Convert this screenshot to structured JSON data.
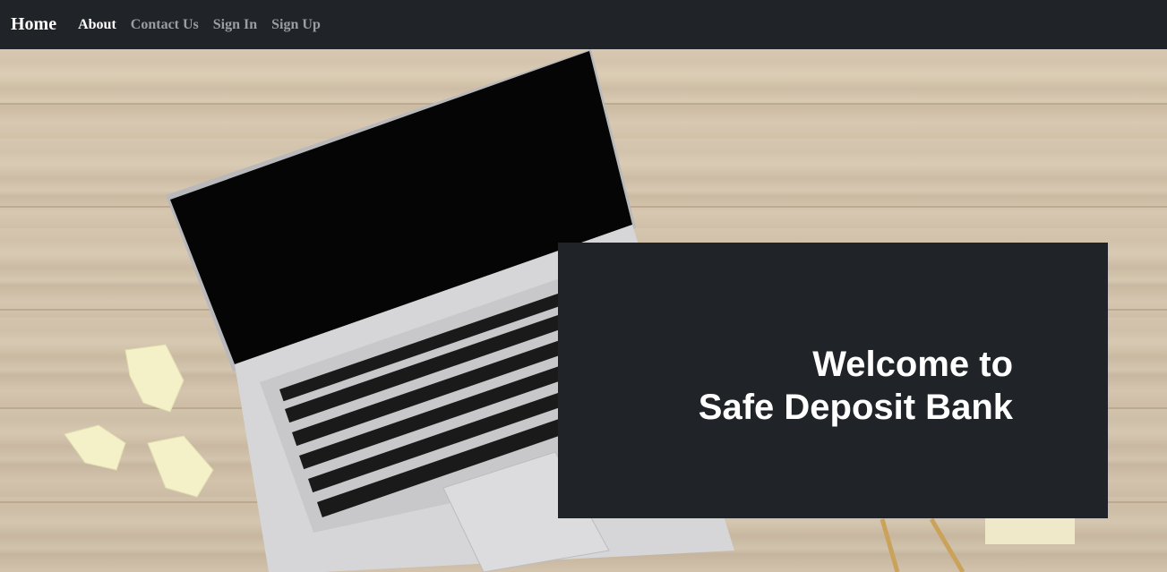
{
  "navbar": {
    "brand": "Home",
    "links": [
      {
        "label": "About",
        "active": true
      },
      {
        "label": "Contact Us",
        "active": false
      },
      {
        "label": "Sign In",
        "active": false
      },
      {
        "label": "Sign Up",
        "active": false
      }
    ]
  },
  "hero": {
    "background_description_icon": "laptop-on-wooden-desk-image"
  },
  "welcome": {
    "line1": "Welcome to",
    "line2": "Safe Deposit Bank"
  },
  "colors": {
    "navbar_bg": "#202327",
    "panel_bg": "#202327",
    "link_active": "#ffffff",
    "link_muted": "#9a9da1"
  }
}
